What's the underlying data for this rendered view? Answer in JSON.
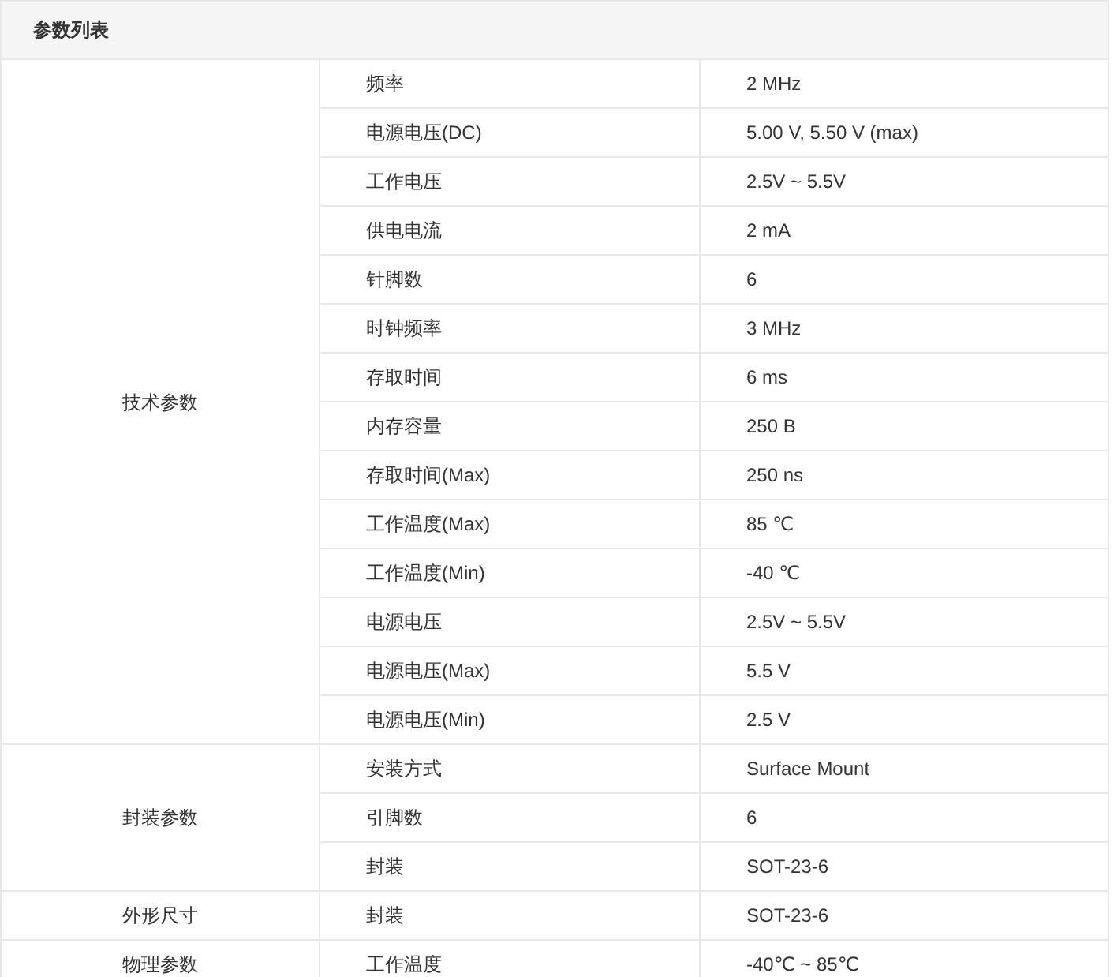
{
  "title": "参数列表",
  "groups": [
    {
      "name": "技术参数",
      "params": [
        {
          "name": "频率",
          "value": "2 MHz"
        },
        {
          "name": "电源电压(DC)",
          "value": "5.00 V, 5.50 V (max)"
        },
        {
          "name": "工作电压",
          "value": "2.5V ~ 5.5V"
        },
        {
          "name": "供电电流",
          "value": "2 mA"
        },
        {
          "name": "针脚数",
          "value": "6"
        },
        {
          "name": "时钟频率",
          "value": "3 MHz"
        },
        {
          "name": "存取时间",
          "value": "6 ms"
        },
        {
          "name": "内存容量",
          "value": "250 B"
        },
        {
          "name": "存取时间(Max)",
          "value": "250 ns"
        },
        {
          "name": "工作温度(Max)",
          "value": "85 ℃"
        },
        {
          "name": "工作温度(Min)",
          "value": "-40 ℃"
        },
        {
          "name": "电源电压",
          "value": "2.5V ~ 5.5V"
        },
        {
          "name": "电源电压(Max)",
          "value": "5.5 V"
        },
        {
          "name": "电源电压(Min)",
          "value": "2.5 V"
        }
      ]
    },
    {
      "name": "封装参数",
      "params": [
        {
          "name": "安装方式",
          "value": "Surface Mount"
        },
        {
          "name": "引脚数",
          "value": "6"
        },
        {
          "name": "封装",
          "value": "SOT-23-6"
        }
      ]
    },
    {
      "name": "外形尺寸",
      "params": [
        {
          "name": "封装",
          "value": "SOT-23-6"
        }
      ]
    },
    {
      "name": "物理参数",
      "params": [
        {
          "name": "工作温度",
          "value": "-40℃ ~ 85℃"
        }
      ]
    }
  ]
}
